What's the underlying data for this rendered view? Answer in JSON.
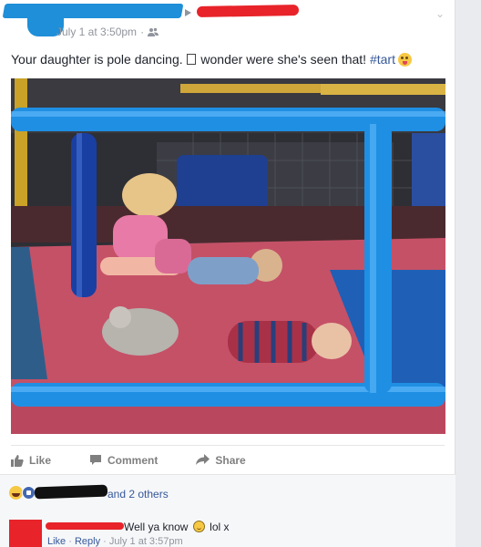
{
  "post": {
    "timestamp": "July 1 at 3:50pm",
    "separator": "·",
    "text_before_box": "Your daughter is pole dancing. ",
    "text_after_box": " wonder were she's seen that! ",
    "hashtag": "#tart",
    "menu_icon": "chevron-down-icon",
    "audience_icon": "friends-icon"
  },
  "actions": {
    "like": "Like",
    "comment": "Comment",
    "share": "Share"
  },
  "reactions": {
    "others": "and 2 others",
    "icons": [
      "haha-icon",
      "like-icon"
    ]
  },
  "comment": {
    "text_before_emoji": "Well ya know ",
    "text_after_emoji": " lol x",
    "like_label": "Like",
    "reply_label": "Reply",
    "timestamp": "July 1 at 3:57pm",
    "separator": "·"
  },
  "colors": {
    "link": "#365899",
    "meta": "#90949c",
    "redact_blue": "#1e8fd8",
    "redact_red": "#e8232a"
  }
}
